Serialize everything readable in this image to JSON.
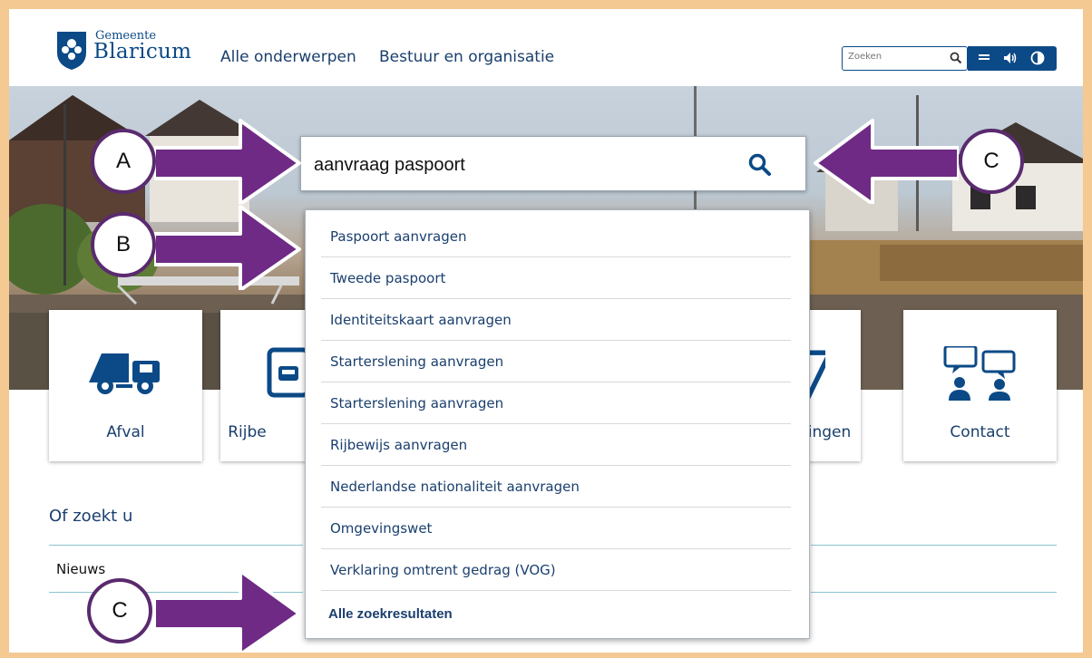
{
  "header": {
    "logo_small": "Gemeente",
    "logo_big": "Blaricum",
    "nav": [
      "Alle onderwerpen",
      "Bestuur en organisatie"
    ],
    "search_placeholder": "Zoeken"
  },
  "tiles": [
    "Afval",
    "Rijbe",
    "ingen",
    "Contact"
  ],
  "search": {
    "query": "aanvraag paspoort",
    "suggestions": [
      "Paspoort aanvragen",
      "Tweede paspoort",
      "Identiteitskaart aanvragen",
      "Starterslening aanvragen",
      "Starterslening aanvragen",
      "Rijbewijs aanvragen",
      "Nederlandse nationaliteit aanvragen",
      "Omgevingswet",
      "Verklaring omtrent gedrag (VOG)"
    ],
    "all_results": "Alle zoekresultaten"
  },
  "section": {
    "title": "Of zoekt u",
    "item": "Nieuws"
  },
  "annotations": [
    "A",
    "B",
    "C",
    "C"
  ],
  "colors": {
    "brand": "#0b4a86",
    "text": "#1a3f6e",
    "arrow": "#6e2a84",
    "frame": "#f5c992"
  }
}
